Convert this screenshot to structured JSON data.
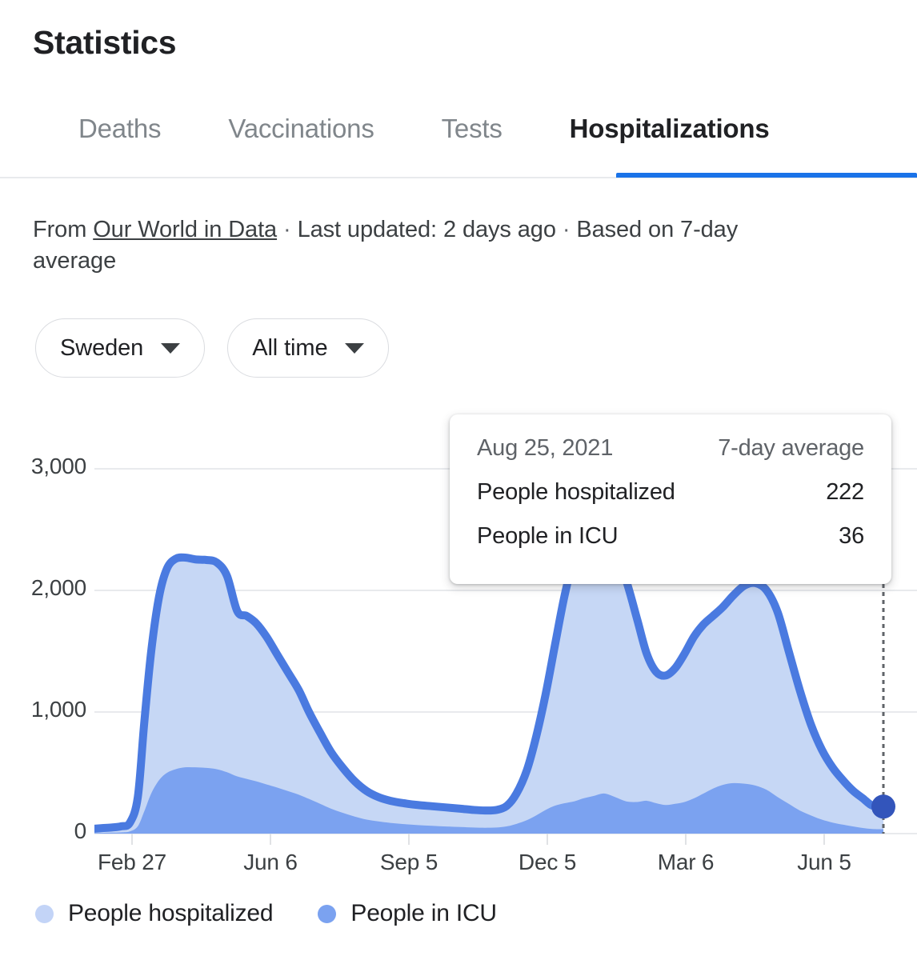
{
  "header": {
    "title": "Statistics"
  },
  "tabs": [
    {
      "label": "Deaths",
      "active": false
    },
    {
      "label": "Vaccinations",
      "active": false
    },
    {
      "label": "Tests",
      "active": false
    },
    {
      "label": "Hospitalizations",
      "active": true
    }
  ],
  "source": {
    "prefix": "From ",
    "link": "Our World in Data",
    "sep1": " · ",
    "updated": "Last updated: 2 days ago",
    "sep2": " · ",
    "basis": "Based on 7-day average"
  },
  "filters": {
    "region": {
      "label": "Sweden",
      "caret": "chevron-down-icon"
    },
    "range": {
      "label": "All time",
      "caret": "chevron-down-icon"
    }
  },
  "tooltip": {
    "date": "Aug 25, 2021",
    "average_label": "7-day average",
    "rows": [
      {
        "name": "People hospitalized",
        "value": "222"
      },
      {
        "name": "People in ICU",
        "value": "36"
      }
    ]
  },
  "legend": [
    {
      "label": "People hospitalized",
      "color": "#c3d4f7"
    },
    {
      "label": "People in ICU",
      "color": "#7ba2f0"
    }
  ],
  "colors": {
    "accent": "#1a73e8",
    "line_stroke": "#4a7ae0",
    "hospitalized_fill": "#c6d7f5",
    "icu_fill": "#7ba2f0",
    "endpoint_dot": "#3355bb",
    "grid": "#e8eaed",
    "text_primary": "#202124",
    "text_secondary": "#5f6368"
  },
  "chart_data": {
    "type": "area",
    "title": "",
    "xlabel": "",
    "ylabel": "",
    "ylim": [
      0,
      3000
    ],
    "yticks": [
      "0",
      "1,000",
      "2,000",
      "3,000"
    ],
    "ytick_values": [
      0,
      1000,
      2000,
      3000
    ],
    "xticks": [
      "Feb 27",
      "Jun 6",
      "Sep 5",
      "Dec 5",
      "Mar 6",
      "Jun 5"
    ],
    "grid": true,
    "legend_position": "bottom-left",
    "stacked": false,
    "annotations": [
      {
        "type": "vertical-dotted-line",
        "at_x_fraction": 1.0
      },
      {
        "type": "endpoint-marker",
        "series": "People hospitalized",
        "value": 222
      }
    ],
    "series": [
      {
        "name": "People hospitalized",
        "color": "#c6d7f5",
        "stroke": "#4a7ae0",
        "x": [
          0,
          0.01,
          0.022,
          0.034,
          0.045,
          0.055,
          0.063,
          0.072,
          0.082,
          0.092,
          0.103,
          0.115,
          0.128,
          0.142,
          0.155,
          0.168,
          0.181,
          0.193,
          0.205,
          0.218,
          0.231,
          0.245,
          0.259,
          0.272,
          0.286,
          0.3,
          0.315,
          0.33,
          0.345,
          0.36,
          0.375,
          0.392,
          0.41,
          0.428,
          0.446,
          0.464,
          0.48,
          0.495,
          0.51,
          0.523,
          0.535,
          0.548,
          0.56,
          0.572,
          0.584,
          0.596,
          0.608,
          0.62,
          0.633,
          0.646,
          0.66,
          0.674,
          0.688,
          0.7,
          0.712,
          0.724,
          0.736,
          0.748,
          0.76,
          0.772,
          0.784,
          0.796,
          0.81,
          0.824,
          0.838,
          0.852,
          0.866,
          0.88,
          0.894,
          0.908,
          0.922,
          0.936,
          0.95,
          0.962,
          0.974,
          0.986,
          1.0
        ],
        "y": [
          40,
          45,
          50,
          60,
          90,
          300,
          900,
          1500,
          1950,
          2180,
          2260,
          2270,
          2255,
          2250,
          2230,
          2120,
          1830,
          1790,
          1730,
          1620,
          1480,
          1330,
          1180,
          1000,
          830,
          670,
          540,
          430,
          350,
          300,
          270,
          250,
          235,
          225,
          215,
          205,
          195,
          190,
          195,
          230,
          330,
          520,
          800,
          1150,
          1560,
          1960,
          2260,
          2430,
          2470,
          2420,
          2300,
          2080,
          1760,
          1480,
          1330,
          1300,
          1360,
          1480,
          1620,
          1720,
          1790,
          1860,
          1960,
          2040,
          2060,
          2000,
          1820,
          1500,
          1180,
          900,
          690,
          540,
          430,
          350,
          290,
          230,
          222
        ]
      },
      {
        "name": "People in ICU",
        "color": "#7ba2f0",
        "stroke": "none",
        "x": [
          0,
          0.01,
          0.022,
          0.034,
          0.045,
          0.055,
          0.063,
          0.072,
          0.082,
          0.092,
          0.103,
          0.115,
          0.128,
          0.142,
          0.155,
          0.168,
          0.181,
          0.193,
          0.205,
          0.218,
          0.231,
          0.245,
          0.259,
          0.272,
          0.286,
          0.3,
          0.315,
          0.33,
          0.345,
          0.36,
          0.375,
          0.392,
          0.41,
          0.428,
          0.446,
          0.464,
          0.48,
          0.495,
          0.51,
          0.523,
          0.535,
          0.548,
          0.56,
          0.572,
          0.584,
          0.596,
          0.608,
          0.62,
          0.633,
          0.646,
          0.66,
          0.674,
          0.688,
          0.7,
          0.712,
          0.724,
          0.736,
          0.748,
          0.76,
          0.772,
          0.784,
          0.796,
          0.81,
          0.824,
          0.838,
          0.852,
          0.866,
          0.88,
          0.894,
          0.908,
          0.922,
          0.936,
          0.95,
          0.962,
          0.974,
          0.986,
          1.0
        ],
        "y": [
          5,
          6,
          8,
          10,
          18,
          60,
          180,
          330,
          440,
          500,
          530,
          545,
          545,
          540,
          530,
          505,
          470,
          450,
          430,
          405,
          380,
          350,
          320,
          285,
          245,
          205,
          170,
          140,
          115,
          100,
          88,
          78,
          70,
          64,
          58,
          54,
          50,
          48,
          50,
          60,
          80,
          110,
          150,
          195,
          230,
          250,
          265,
          290,
          310,
          330,
          300,
          265,
          260,
          270,
          250,
          235,
          245,
          260,
          290,
          330,
          370,
          400,
          415,
          410,
          395,
          360,
          300,
          245,
          190,
          150,
          115,
          90,
          72,
          58,
          46,
          38,
          36
        ]
      }
    ]
  }
}
